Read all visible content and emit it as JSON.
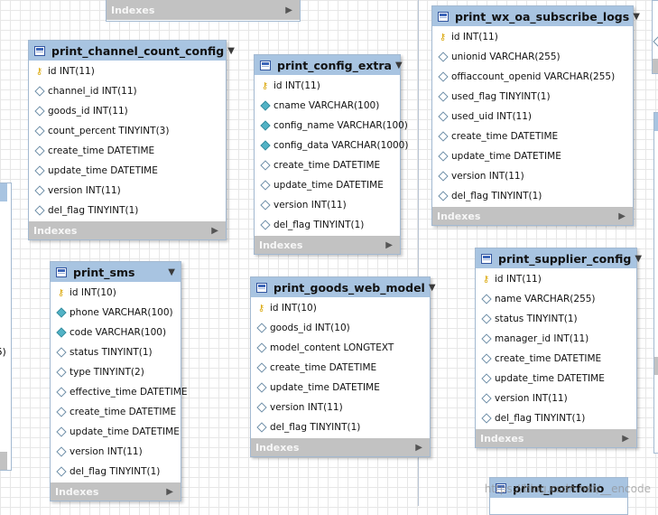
{
  "tables": [
    {
      "id": "print_channel_count_config",
      "name": "print_channel_count_config",
      "indexes_label": "Indexes",
      "columns": [
        {
          "icon": "key",
          "text": "id INT(11)"
        },
        {
          "icon": "diamond",
          "text": "channel_id INT(11)"
        },
        {
          "icon": "diamond",
          "text": "goods_id INT(11)"
        },
        {
          "icon": "diamond",
          "text": "count_percent TINYINT(3)"
        },
        {
          "icon": "diamond",
          "text": "create_time DATETIME"
        },
        {
          "icon": "diamond",
          "text": "update_time DATETIME"
        },
        {
          "icon": "diamond",
          "text": "version INT(11)"
        },
        {
          "icon": "diamond",
          "text": "del_flag TINYINT(1)"
        }
      ]
    },
    {
      "id": "print_config_extra",
      "name": "print_config_extra",
      "indexes_label": "Indexes",
      "columns": [
        {
          "icon": "key",
          "text": "id INT(11)"
        },
        {
          "icon": "diamond-filled",
          "text": "cname VARCHAR(100)"
        },
        {
          "icon": "diamond-filled",
          "text": "config_name VARCHAR(100)"
        },
        {
          "icon": "diamond-filled",
          "text": "config_data VARCHAR(1000)"
        },
        {
          "icon": "diamond",
          "text": "create_time DATETIME"
        },
        {
          "icon": "diamond",
          "text": "update_time DATETIME"
        },
        {
          "icon": "diamond",
          "text": "version INT(11)"
        },
        {
          "icon": "diamond",
          "text": "del_flag TINYINT(1)"
        }
      ]
    },
    {
      "id": "print_wx_oa_subscribe_logs",
      "name": "print_wx_oa_subscribe_logs",
      "indexes_label": "Indexes",
      "columns": [
        {
          "icon": "key",
          "text": "id INT(11)"
        },
        {
          "icon": "diamond",
          "text": "unionid VARCHAR(255)"
        },
        {
          "icon": "diamond",
          "text": "offiaccount_openid VARCHAR(255)"
        },
        {
          "icon": "diamond",
          "text": "used_flag TINYINT(1)"
        },
        {
          "icon": "diamond",
          "text": "used_uid INT(11)"
        },
        {
          "icon": "diamond",
          "text": "create_time DATETIME"
        },
        {
          "icon": "diamond",
          "text": "update_time DATETIME"
        },
        {
          "icon": "diamond",
          "text": "version INT(11)"
        },
        {
          "icon": "diamond",
          "text": "del_flag TINYINT(1)"
        }
      ]
    },
    {
      "id": "print_sms",
      "name": "print_sms",
      "indexes_label": "Indexes",
      "columns": [
        {
          "icon": "key",
          "text": "id INT(10)"
        },
        {
          "icon": "diamond-filled",
          "text": "phone VARCHAR(100)"
        },
        {
          "icon": "diamond-filled",
          "text": "code VARCHAR(100)"
        },
        {
          "icon": "diamond",
          "text": "status TINYINT(1)"
        },
        {
          "icon": "diamond",
          "text": "type TINYINT(2)"
        },
        {
          "icon": "diamond",
          "text": "effective_time DATETIME"
        },
        {
          "icon": "diamond",
          "text": "create_time DATETIME"
        },
        {
          "icon": "diamond",
          "text": "update_time DATETIME"
        },
        {
          "icon": "diamond",
          "text": "version INT(11)"
        },
        {
          "icon": "diamond",
          "text": "del_flag TINYINT(1)"
        }
      ]
    },
    {
      "id": "print_goods_web_model",
      "name": "print_goods_web_model",
      "indexes_label": "Indexes",
      "columns": [
        {
          "icon": "key",
          "text": "id INT(10)"
        },
        {
          "icon": "diamond",
          "text": "goods_id INT(10)"
        },
        {
          "icon": "diamond",
          "text": "model_content LONGTEXT"
        },
        {
          "icon": "diamond",
          "text": "create_time DATETIME"
        },
        {
          "icon": "diamond",
          "text": "update_time DATETIME"
        },
        {
          "icon": "diamond",
          "text": "version INT(11)"
        },
        {
          "icon": "diamond",
          "text": "del_flag TINYINT(1)"
        }
      ]
    },
    {
      "id": "print_supplier_config",
      "name": "print_supplier_config",
      "indexes_label": "Indexes",
      "columns": [
        {
          "icon": "key",
          "text": "id INT(11)"
        },
        {
          "icon": "diamond",
          "text": "name VARCHAR(255)"
        },
        {
          "icon": "diamond",
          "text": "status TINYINT(1)"
        },
        {
          "icon": "diamond",
          "text": "manager_id INT(11)"
        },
        {
          "icon": "diamond",
          "text": "create_time DATETIME"
        },
        {
          "icon": "diamond",
          "text": "update_time DATETIME"
        },
        {
          "icon": "diamond",
          "text": "version INT(11)"
        },
        {
          "icon": "diamond",
          "text": "del_flag TINYINT(1)"
        }
      ]
    },
    {
      "id": "print_portfolio",
      "name": "print_portfolio",
      "indexes_label": "",
      "columns": []
    }
  ],
  "top_fragment": {
    "indexes_label": "Indexes"
  },
  "left_fragment_text": "5)",
  "watermark": "https://blog.csdn.net/__encode"
}
